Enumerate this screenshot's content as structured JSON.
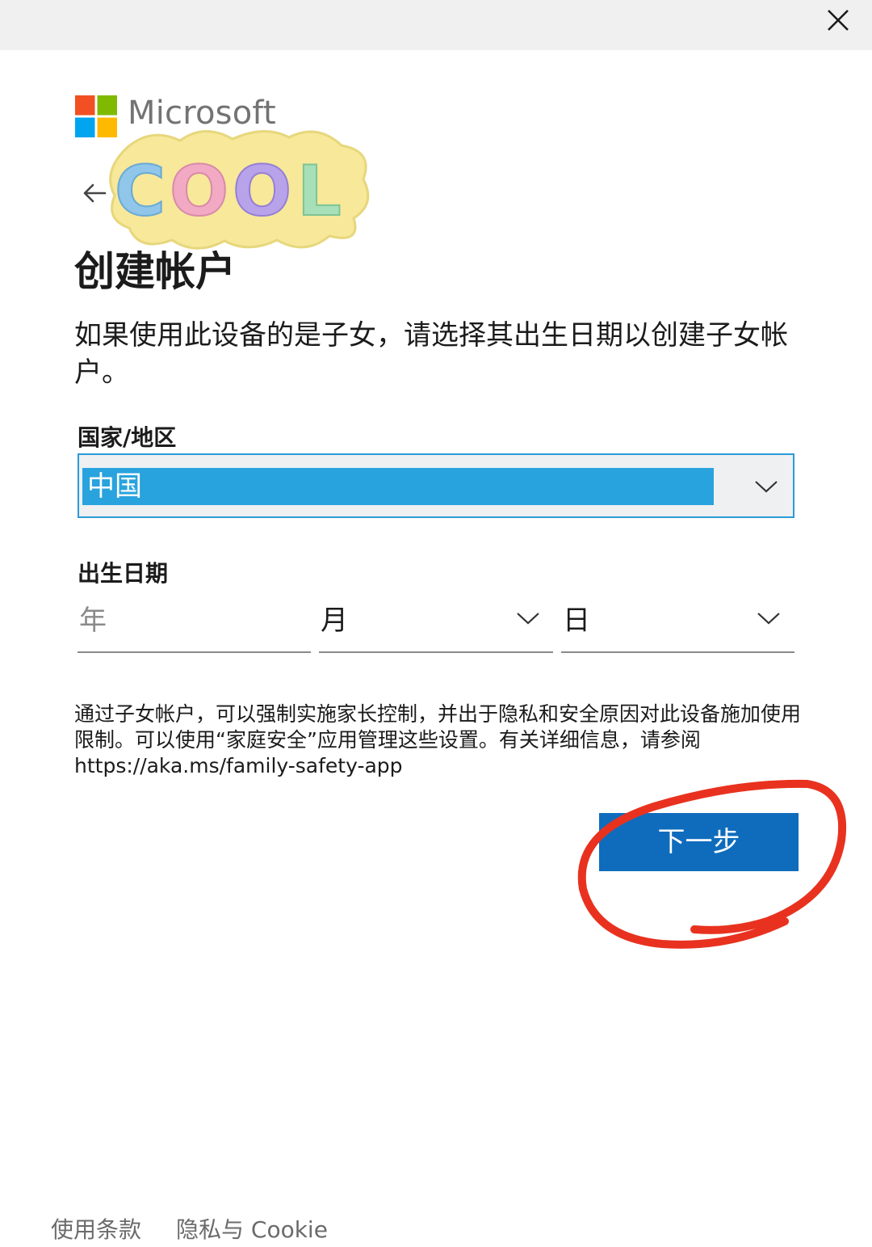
{
  "window": {
    "close_icon": "close-icon"
  },
  "brand": {
    "name": "Microsoft",
    "logo_colors": [
      "#f25022",
      "#7fba00",
      "#00a4ef",
      "#ffb900"
    ]
  },
  "navigation": {
    "back_icon": "arrow-left-icon"
  },
  "sticker": {
    "text": "COOL"
  },
  "header": {
    "title": "创建帐户"
  },
  "intro": {
    "text": "如果使用此设备的是子女，请选择其出生日期以创建子女帐户。"
  },
  "country": {
    "label": "国家/地区",
    "selected": "中国"
  },
  "birthdate": {
    "label": "出生日期",
    "year_placeholder": "年",
    "month_value": "月",
    "day_value": "日"
  },
  "info": {
    "text": "通过子女帐户，可以强制实施家长控制，并出于隐私和安全原因对此设备施加使用限制。可以使用“家庭安全”应用管理这些设置。有关详细信息，请参阅 https://aka.ms/family-safety-app"
  },
  "actions": {
    "next_label": "下一步"
  },
  "footer": {
    "terms_label": "使用条款",
    "privacy_label": "隐私与 Cookie"
  },
  "colors": {
    "accent": "#0f6cbd",
    "selection": "#29a3de",
    "annotation": "#e8321f"
  }
}
